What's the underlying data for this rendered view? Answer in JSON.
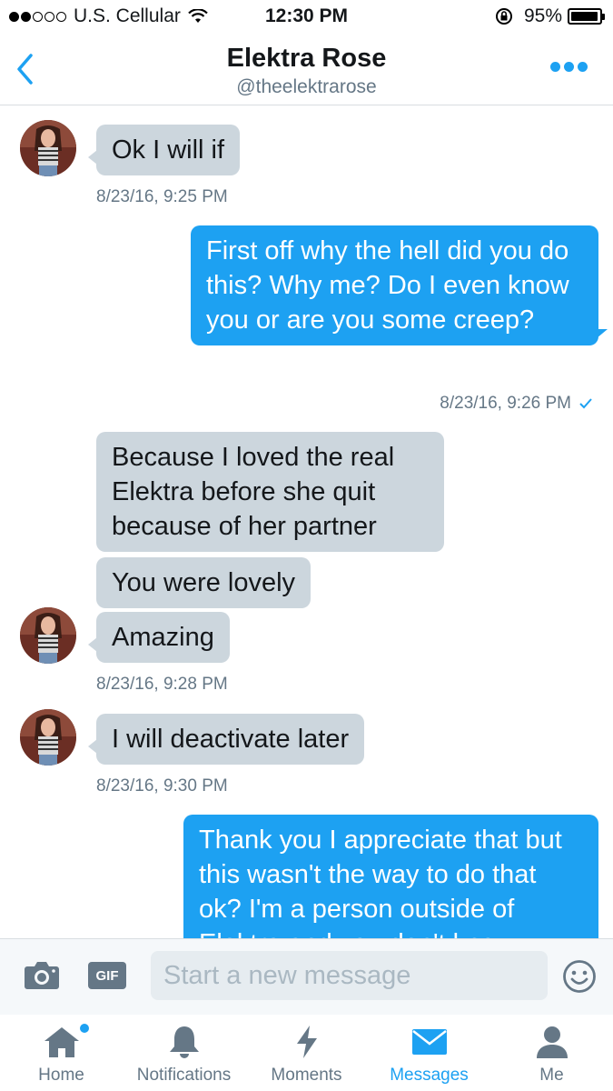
{
  "status_bar": {
    "carrier": "U.S. Cellular",
    "time": "12:30 PM",
    "battery": "95%",
    "battery_level": 0.95,
    "signal_bars_filled": 2,
    "signal_bars_total": 5
  },
  "header": {
    "title": "Elektra Rose",
    "handle": "@theelektrarose",
    "back_icon": "chevron-left-icon",
    "more_icon": "more-dots-icon",
    "accent_color": "#1da1f2"
  },
  "messages": [
    {
      "direction": "incoming",
      "text": "Ok I will if"
    },
    {
      "direction": "incoming",
      "timestamp": "8/23/16, 9:25 PM"
    },
    {
      "direction": "outgoing",
      "text": "First off why the hell did you do this? Why me? Do I even know you or are you some creep?"
    },
    {
      "direction": "outgoing",
      "timestamp": "8/23/16, 9:26 PM",
      "read": true
    },
    {
      "direction": "incoming",
      "text": "Because I loved the real Elektra before she quit because of her partner"
    },
    {
      "direction": "incoming",
      "text": "You were lovely"
    },
    {
      "direction": "incoming",
      "text": "Amazing"
    },
    {
      "direction": "incoming",
      "timestamp": "8/23/16, 9:28 PM"
    },
    {
      "direction": "incoming",
      "text": "I will deactivate later"
    },
    {
      "direction": "incoming",
      "timestamp": "8/23/16, 9:30 PM"
    },
    {
      "direction": "outgoing",
      "text": "Thank you I appreciate that but this wasn't the way to do that ok? I'm a person outside of Elektra and you don't know"
    }
  ],
  "composer": {
    "placeholder": "Start a new message",
    "gif_label": "GIF",
    "camera_icon": "camera-icon",
    "emoji_icon": "emoji-icon"
  },
  "tabbar": {
    "tabs": [
      {
        "label": "Home",
        "icon": "home-icon",
        "active": false,
        "has_badge": true
      },
      {
        "label": "Notifications",
        "icon": "bell-icon",
        "active": false
      },
      {
        "label": "Moments",
        "icon": "lightning-icon",
        "active": false
      },
      {
        "label": "Messages",
        "icon": "envelope-icon",
        "active": true
      },
      {
        "label": "Me",
        "icon": "person-icon",
        "active": false
      }
    ]
  },
  "colors": {
    "incoming_bubble": "#ccd6dd",
    "outgoing_bubble": "#1da1f2",
    "meta_text": "#657786"
  }
}
